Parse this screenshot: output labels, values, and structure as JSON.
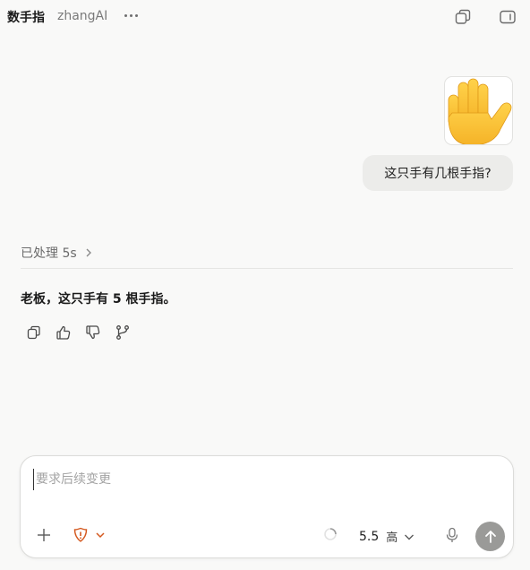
{
  "header": {
    "title": "数手指",
    "subtitle": "zhangAI"
  },
  "conversation": {
    "user_image_icon": "raised-hand-emoji",
    "user_message": "这只手有几根手指?",
    "processed_label": "已处理 5s",
    "assistant_reply_prefix": "老板，这只手有 ",
    "assistant_reply_number": "5",
    "assistant_reply_suffix": " 根手指。"
  },
  "composer": {
    "placeholder": "要求后续变更",
    "model_version": "5.5",
    "quality_label": "高"
  },
  "colors": {
    "background": "#f9f9f8",
    "user_bubble": "#ececea",
    "warning_accent": "#d4581e",
    "send_button": "#9a9a98"
  }
}
